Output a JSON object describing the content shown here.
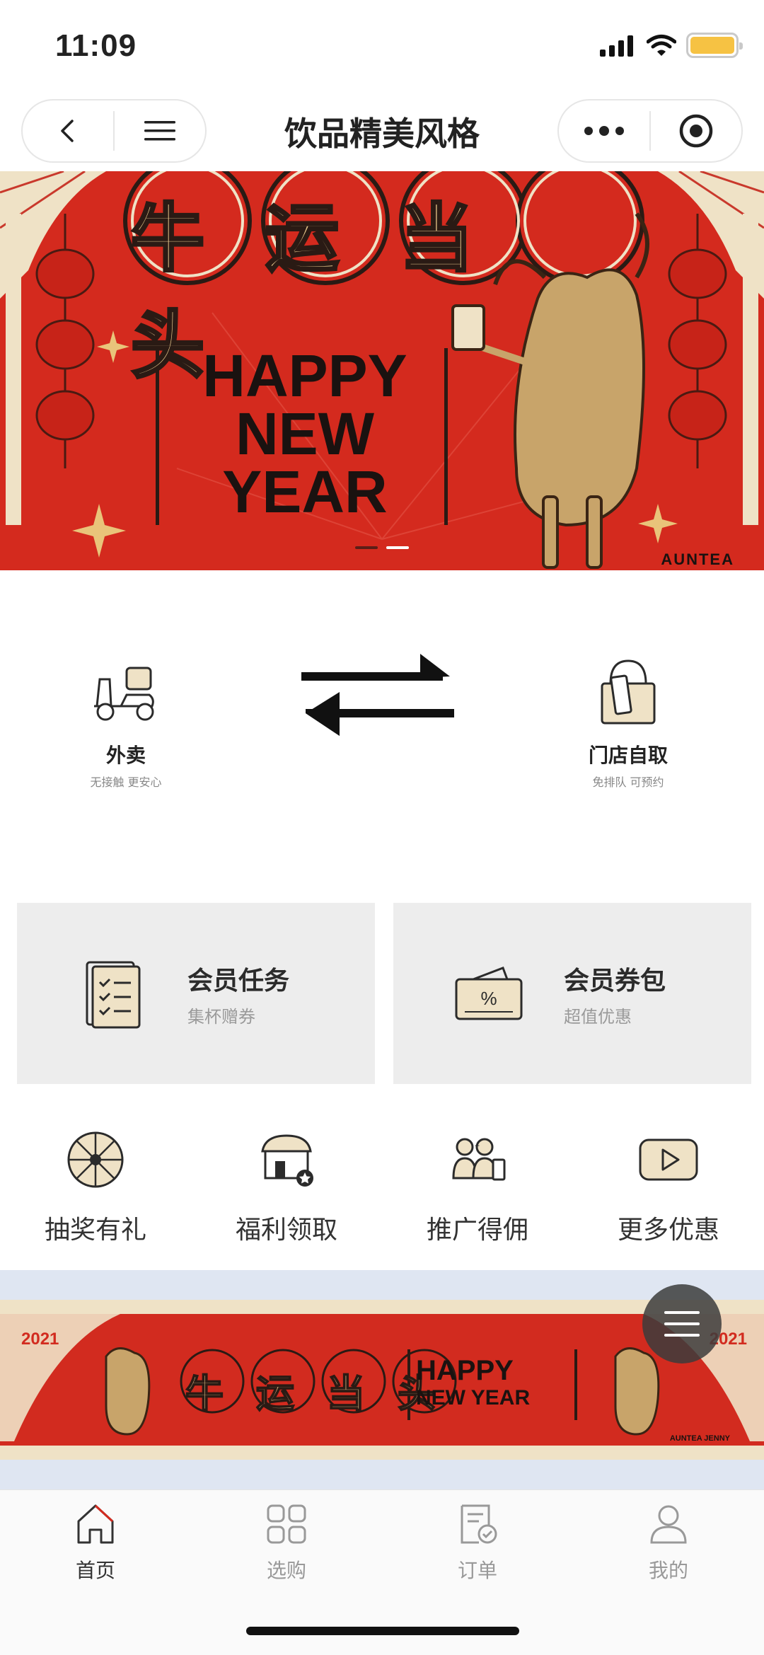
{
  "status": {
    "time": "11:09"
  },
  "nav": {
    "title": "饮品精美风格"
  },
  "banner": {
    "title_cn": "牛运当头",
    "line1": "HAPPY",
    "line2": "NEW",
    "line3": "YEAR",
    "brand": "AUNTEA",
    "slides": 2,
    "active_slide": 2
  },
  "modes": [
    {
      "name": "外卖",
      "sub": "无接触 更安心"
    },
    {
      "name": "门店自取",
      "sub": "免排队 可预约"
    }
  ],
  "cards": [
    {
      "title": "会员任务",
      "sub": "集杯赠券"
    },
    {
      "title": "会员券包",
      "sub": "超值优惠"
    }
  ],
  "quick": [
    {
      "label": "抽奖有礼"
    },
    {
      "label": "福利领取"
    },
    {
      "label": "推广得佣"
    },
    {
      "label": "更多优惠"
    }
  ],
  "promo": {
    "year_left": "2021",
    "year_right": "2021",
    "title_cn": "牛运当头",
    "line1": "HAPPY",
    "line2": "NEW YEAR",
    "brand": "AUNTEA JENNY"
  },
  "tabs": [
    {
      "label": "首页"
    },
    {
      "label": "选购"
    },
    {
      "label": "订单"
    },
    {
      "label": "我的"
    }
  ],
  "colors": {
    "accent": "#d22b1f",
    "gold": "#c8a46a",
    "card_bg": "#ededed"
  }
}
